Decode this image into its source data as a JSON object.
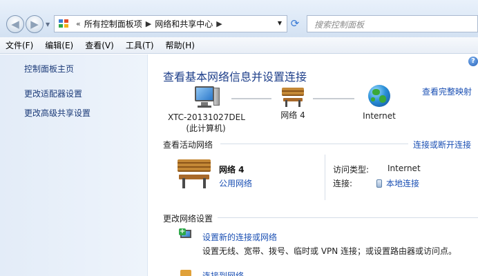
{
  "address_bar": {
    "breadcrumbs": [
      "所有控制面板项",
      "网络和共享中心"
    ],
    "overflow_glyph": "«",
    "search_placeholder": "搜索控制面板"
  },
  "menu": [
    "文件(F)",
    "编辑(E)",
    "查看(V)",
    "工具(T)",
    "帮助(H)"
  ],
  "sidebar": {
    "items": [
      "控制面板主页",
      "更改适配器设置",
      "更改高级共享设置"
    ]
  },
  "main": {
    "title": "查看基本网络信息并设置连接",
    "view_full_map": "查看完整映射",
    "map": {
      "computer_name": "XTC-20131027DEL",
      "computer_sub": "(此计算机)",
      "network": "网络 4",
      "internet": "Internet"
    },
    "active_section": {
      "header": "查看活动网络",
      "connect_disconnect": "连接或断开连接",
      "network_name": "网络 4",
      "network_type": "公用网络",
      "access_type_label": "访问类型:",
      "access_type_value": "Internet",
      "connection_label": "连接:",
      "connection_value": "本地连接"
    },
    "change_section": {
      "header": "更改网络设置",
      "tasks": [
        {
          "title": "设置新的连接或网络",
          "desc": "设置无线、宽带、拨号、临时或 VPN 连接；或设置路由器或访问点。"
        },
        {
          "title": "连接到网络",
          "desc": ""
        }
      ]
    }
  },
  "colors": {
    "link": "#1a4fb3",
    "title": "#1e3f8a",
    "sidebar_bg": "#e3ecf8"
  }
}
